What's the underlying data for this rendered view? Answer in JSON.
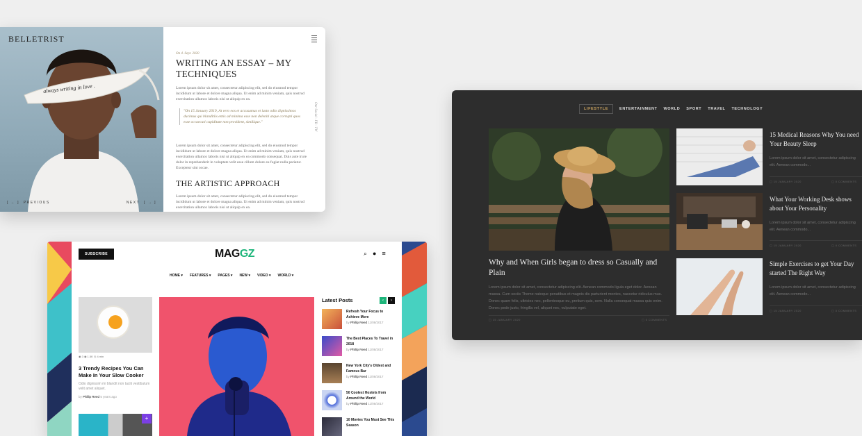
{
  "belletrist": {
    "logo": "BELLETRIST",
    "handwriting": "always writing in love .",
    "prev_label": "PREVIOUS",
    "next_label": "NEXT",
    "date": "On 4. Sept. 2020",
    "title": "Writing an essay – my techniques",
    "para1": "Lorem ipsum dolor sit amet, consectetur adipiscing elit, sed do eiusmod tempor incididunt ut labore et dolore magna aliqua. Ut enim ad minim veniam, quis nostrud exercitation ullamco laboris nisi ut aliquip ex ea.",
    "quote": "\"On 15 January 2019, At vero eos et accusamus et iusto odio dignissimos ducimus qui blanditiis entis ad minima esse non deleniti atque corrupti quos esse occaecati cupiditate non provident, similique.\"",
    "para2": "Lorem ipsum dolor sit amet, consectetur adipiscing elit, sed do eiusmod tempor incididunt ut labore et dolore magna aliqua. Ut enim ad minim veniam, quis nostrud exercitation ullamco laboris nisi ut aliquip ex ea commodo consequat. Duis aute irure dolor in reprehenderit in voluptate velit esse cillum dolore eu fugiat nulla pariatur. Excepteur sint occae.",
    "subtitle": "The artistic approach",
    "para3": "Lorem ipsum dolor sit amet, consectetur adipiscing elit, sed do eiusmod tempor incididunt ut labore et dolore magna aliqua. Ut enim ad minim veniam, quis nostrud exercitation ullamco laboris nisi ut aliquip ex ea.",
    "side_label": "Our Social · FB · TW"
  },
  "maggz": {
    "subscribe": "SUBSCRIBE",
    "brand_a": "MAG",
    "brand_b": "GZ",
    "menu": [
      "HOME ▾",
      "FEATURES ▾",
      "PAGES ▾",
      "NEW ▾",
      "VIDEO ▾",
      "WORLD ▾"
    ],
    "left_stats": "◉ 3     ◉ 1.5K     ◷ 4 min",
    "left_title": "3 Trendy Recipes You Can Make In Your Slow Cooker",
    "left_excerpt": "Odio dignissim mi blandit non taciti vestibulum velit amet aliquet.",
    "left_by": "by",
    "left_author": "Phillip Reed",
    "left_ago": "5 years ago",
    "latest_title": "Latest Posts",
    "posts": [
      {
        "title": "Refresh Your Focus to Achieve More",
        "author": "Phillip Reed",
        "date": "11/08/2017"
      },
      {
        "title": "The Best Places To Travel in 2018",
        "author": "Phillip Reed",
        "date": "11/08/2017"
      },
      {
        "title": "New York City's Oldest and Famous Bar",
        "author": "Phillip Reed",
        "date": "11/08/2017"
      },
      {
        "title": "50 Coolest Hostels from Around the World",
        "author": "Phillip Reed",
        "date": "11/08/2017"
      },
      {
        "title": "10 Movies You Must See This Season",
        "author": "",
        "date": ""
      }
    ]
  },
  "dark": {
    "nav": [
      "LIFESTYLE",
      "ENTERTAINMENT",
      "WORLD",
      "SPORT",
      "TRAVEL",
      "TECHNOLOGY"
    ],
    "main_title": "Why and When Girls began to dress so Casually and Plain",
    "main_excerpt": "Lorem ipsum dolor sit amet, consectetur adipiscing elit. Aenean commodo ligula eget dolor. Aenean massa. Cum sociis Theme natoque penatibus et magnis dis parturient montes, nascetur ridiculus mus. Donec quam felis, ultricies nec, pellentesque eu, pretium quis, sem. Nulla consequat massa quis enim. Donec pede justo, fringilla vel, aliquet nec, vulputate eget.",
    "main_date": "15 JANUARY 2020",
    "main_comments": "0 COMMENTS",
    "side": [
      {
        "title": "15 Medical Reasons Why You need Your Beauty Sleep",
        "excerpt": "Lorem ipsum dolor sit amet, consectetur adipiscing elit. Aenean commodo...",
        "date": "15 JANUARY 2020",
        "comments": "0 COMMENTS"
      },
      {
        "title": "What Your Working Desk shows about Your Personality",
        "excerpt": "Lorem ipsum dolor sit amet, consectetur adipiscing elit. Aenean commodo...",
        "date": "15 JANUARY 2020",
        "comments": "0 COMMENTS"
      },
      {
        "title": "Simple Exercises to get Your Day started The Right Way",
        "excerpt": "Lorem ipsum dolor sit amet, consectetur adipiscing elit. Aenean commodo...",
        "date": "15 JANUARY 2020",
        "comments": "0 COMMENTS"
      }
    ]
  },
  "colors": {
    "gold": "#c9a25e",
    "maggz_green": "#1db57a",
    "maggz_purple": "#7b3fe4",
    "dark_bg": "#2d2d2d"
  }
}
